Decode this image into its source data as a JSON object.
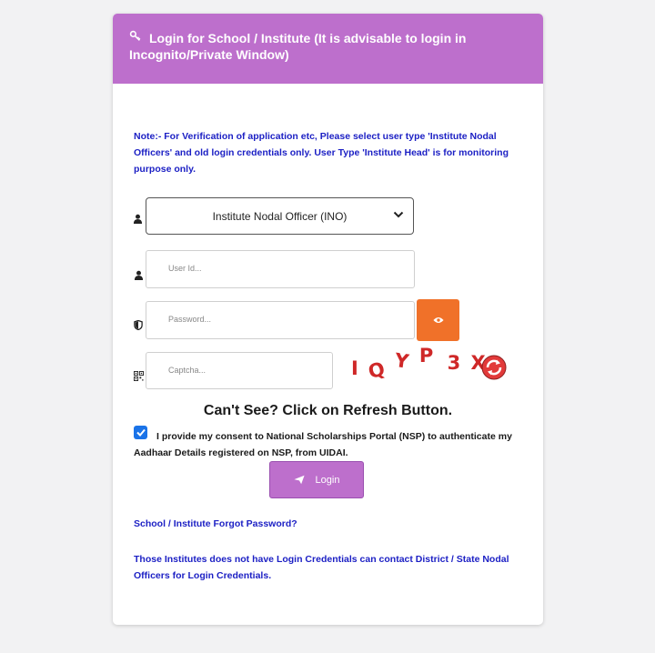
{
  "header": {
    "title": "Login for School / Institute (It is advisable to login in Incognito/Private Window)"
  },
  "note": "Note:- For Verification of application etc, Please select user type 'Institute Nodal Officers' and old login credentials only. User Type 'Institute Head' is for monitoring purpose only.",
  "form": {
    "user_type": {
      "selected": "Institute Nodal Officer (INO)"
    },
    "user_id": {
      "placeholder": "User Id..."
    },
    "password": {
      "placeholder": "Password..."
    },
    "captcha": {
      "placeholder": "Captcha...",
      "chars": [
        "I",
        "Q",
        "Y",
        "P",
        "3",
        "X"
      ],
      "color": "#cf2828"
    },
    "cant_see": "Can't See? Click on Refresh Button.",
    "consent": {
      "checked": true,
      "text": "I provide my consent to National Scholarships Portal (NSP) to authenticate my Aadhaar Details registered on NSP, from UIDAI."
    },
    "login_label": "Login"
  },
  "links": {
    "forgot_password": "School / Institute Forgot Password?",
    "no_credentials": "Those Institutes does not have Login Credentials can contact District / State Nodal Officers for Login Credentials."
  },
  "colors": {
    "accent": "#bd6fcc",
    "eye_button": "#f07129",
    "link": "#1b1fc4"
  },
  "icons": [
    "key-icon",
    "user-icon",
    "shield-icon",
    "qr-icon",
    "eye-icon",
    "refresh-icon",
    "send-icon",
    "chevron-down-icon"
  ]
}
